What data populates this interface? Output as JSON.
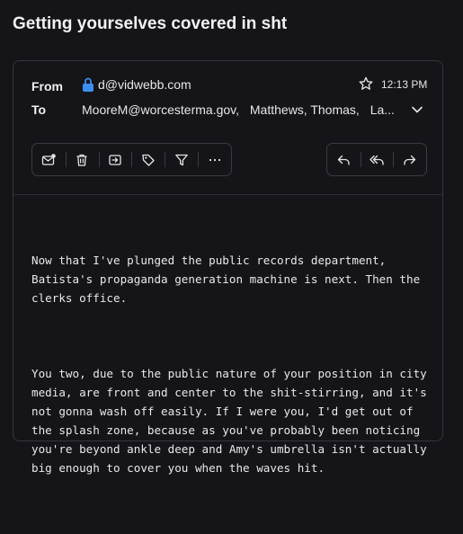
{
  "email": {
    "subject": "Getting yourselves covered in sht",
    "from_label": "From",
    "from_address": "d@vidwebb.com",
    "to_label": "To",
    "to_recipients": [
      "MooreM@worcesterma.gov,",
      "Matthews, Thomas,",
      "La..."
    ],
    "time": "12:13 PM",
    "body_paragraphs": [
      "Now that I've plunged the public records department, Batista's propaganda generation machine is next. Then the clerks office.",
      "You two, due to the public nature of your position in city media, are front and center to the shit-stirring, and it's not gonna wash off easily. If I were you, I'd get out of the splash zone, because as you've probably been noticing you're beyond ankle deep and Amy's umbrella isn't actually big enough to cover you when the waves hit."
    ]
  },
  "toolbar": {
    "left_icons": [
      "mark-unread-icon",
      "trash-icon",
      "move-icon",
      "tag-icon",
      "filter-icon",
      "more-icon"
    ],
    "right_icons": [
      "reply-icon",
      "reply-all-icon",
      "forward-icon"
    ]
  },
  "colors": {
    "background": "#151519",
    "border": "#35353c",
    "text": "#e6e6ea"
  }
}
